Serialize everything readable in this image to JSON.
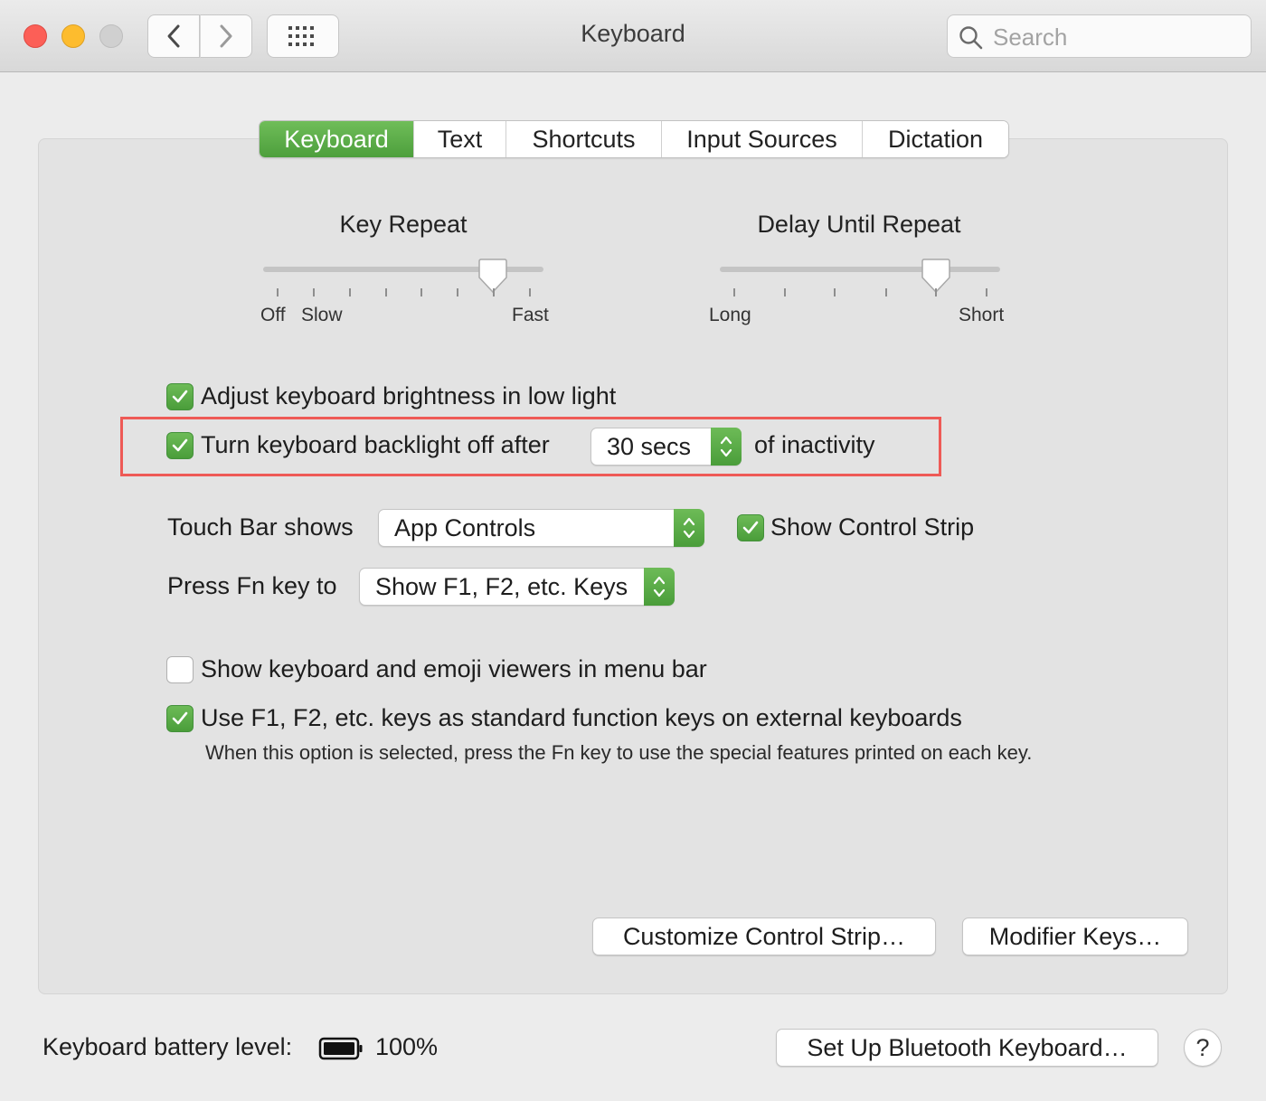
{
  "window": {
    "title": "Keyboard",
    "search_placeholder": "Search"
  },
  "tabs": [
    {
      "label": "Keyboard",
      "active": true
    },
    {
      "label": "Text",
      "active": false
    },
    {
      "label": "Shortcuts",
      "active": false
    },
    {
      "label": "Input Sources",
      "active": false
    },
    {
      "label": "Dictation",
      "active": false
    }
  ],
  "key_repeat": {
    "title": "Key Repeat",
    "labels": [
      "Off",
      "Slow",
      "Fast"
    ],
    "tick_count": 8,
    "selected_step": 7
  },
  "delay_until_repeat": {
    "title": "Delay Until Repeat",
    "labels": [
      "Long",
      "Short"
    ],
    "tick_count": 6,
    "selected_step": 5
  },
  "options": {
    "adjust_brightness": {
      "label": "Adjust keyboard brightness in low light",
      "checked": true
    },
    "backlight_off": {
      "label": "Turn keyboard backlight off after",
      "value": "30 secs",
      "suffix": "of inactivity",
      "checked": true
    },
    "touch_bar": {
      "label": "Touch Bar shows",
      "value": "App Controls"
    },
    "show_control_strip": {
      "label": "Show Control Strip",
      "checked": true
    },
    "fn_key": {
      "label": "Press Fn key to",
      "value": "Show F1, F2, etc. Keys"
    },
    "emoji_viewers": {
      "label": "Show keyboard and emoji viewers in menu bar",
      "checked": false
    },
    "function_keys": {
      "label": "Use F1, F2, etc. keys as standard function keys on external keyboards",
      "note": "When this option is selected, press the Fn key to use the special features printed on each key.",
      "checked": true
    }
  },
  "buttons": {
    "customize_control_strip": "Customize Control Strip…",
    "modifier_keys": "Modifier Keys…",
    "setup_bluetooth": "Set Up Bluetooth Keyboard…",
    "help": "?"
  },
  "battery": {
    "label": "Keyboard battery level:",
    "value": "100%"
  },
  "colors": {
    "accent_green": "#5aac47",
    "highlight_red": "#ee5a56"
  }
}
